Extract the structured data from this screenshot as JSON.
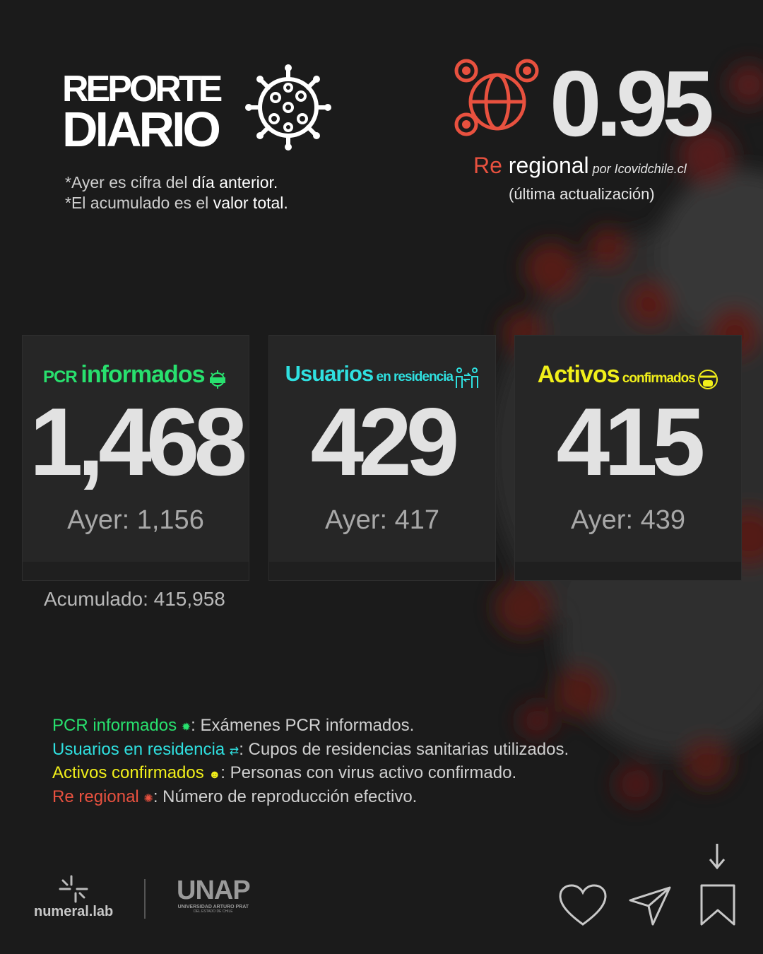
{
  "header": {
    "title_line1": "REPORTE",
    "title_line2": "DIARIO",
    "note1_prefix": "*Ayer es cifra del ",
    "note1_hl": "día anterior.",
    "note2_prefix": "*El acumulado es el ",
    "note2_hl": "valor total."
  },
  "re": {
    "value": "0.95",
    "label_red": "Re",
    "label_white": " regional",
    "source": " por Icovidchile.cl",
    "subtitle": "(última actualización)"
  },
  "cards": [
    {
      "head_big": "informados",
      "head_prefix": "PCR ",
      "value": "1,468",
      "yesterday": "Ayer: 1,156",
      "color": "#28e06e",
      "icon": "alert-virus-icon"
    },
    {
      "head_big": "Usuarios",
      "head_small": " en residencia",
      "value": "429",
      "yesterday": "Ayer: 417",
      "color": "#2fe0e0",
      "icon": "people-exchange-icon"
    },
    {
      "head_big": "Activos",
      "head_small": " confirmados",
      "value": "415",
      "yesterday": "Ayer: 439",
      "color": "#f1ef1a",
      "icon": "masked-face-icon"
    }
  ],
  "accumulated": "Acumulado: 415,958",
  "legend": [
    {
      "term": "PCR informados ",
      "desc": ": Exámenes PCR informados.",
      "color": "#28e06e"
    },
    {
      "term": "Usuarios en residencia ",
      "desc": ": Cupos de residencias sanitarias utilizados.",
      "color": "#2fe0e0"
    },
    {
      "term": "Activos confirmados ",
      "desc": ": Personas con virus activo confirmado.",
      "color": "#f1ef1a"
    },
    {
      "term": "Re regional ",
      "desc": ": Número de reproducción efectivo.",
      "color": "#e8513f"
    }
  ],
  "footer": {
    "numeral": "numeral.lab",
    "unap": "UNAP",
    "unap_sub1": "UNIVERSIDAD ARTURO PRAT",
    "unap_sub2": "DEL ESTADO DE CHILE"
  }
}
